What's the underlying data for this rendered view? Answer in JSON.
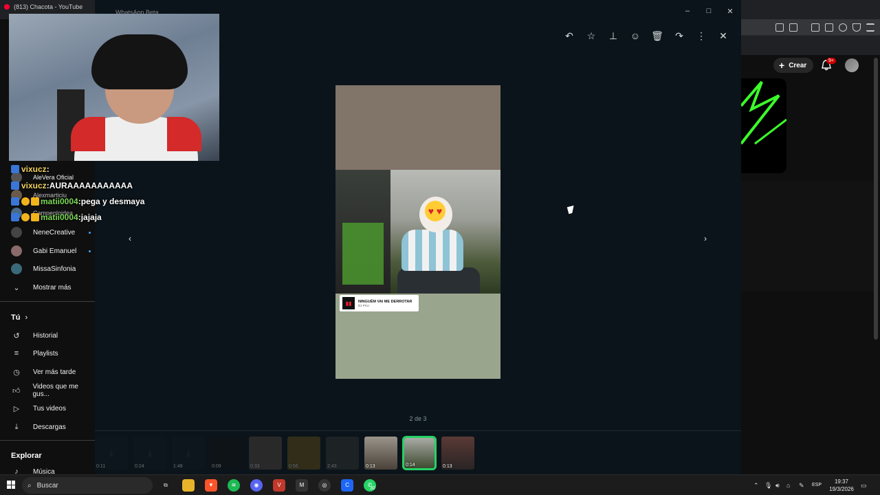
{
  "browser": {
    "tab_title": "(813) Chacota - YouTube",
    "create_label": "Crear",
    "notifications_badge": "9+"
  },
  "sidebar": {
    "subscriptions": [
      {
        "label": "AleVera Oficial"
      },
      {
        "label": "Alexmarticiu"
      },
      {
        "label": "Campeoloidea"
      },
      {
        "label": "NeneCreative"
      },
      {
        "label": "Gabi Emanuel"
      },
      {
        "label": "MissaSinfonia"
      }
    ],
    "show_more": "Mostrar más",
    "you_heading": "Tú",
    "you_items": [
      {
        "label": "Historial",
        "icon": "history-icon"
      },
      {
        "label": "Playlists",
        "icon": "playlists-icon"
      },
      {
        "label": "Ver más tarde",
        "icon": "watch-later-icon"
      },
      {
        "label": "Videos que me gus...",
        "icon": "liked-videos-icon"
      },
      {
        "label": "Tus videos",
        "icon": "your-videos-icon"
      },
      {
        "label": "Descargas",
        "icon": "downloads-icon"
      }
    ],
    "explore_heading": "Explorar",
    "explore_items": [
      {
        "label": "Música",
        "icon": "music-icon"
      }
    ]
  },
  "chat": [
    {
      "user": "vixucz",
      "sep": " :",
      "message": ""
    },
    {
      "user": "vixucz",
      "sep": " :",
      "message": " AURAAAAAAAAAAA"
    },
    {
      "user": "matii0004",
      "sep": " :",
      "message": " pega y desmaya"
    },
    {
      "user": "matii0004",
      "sep": " :",
      "message": " jajaja"
    }
  ],
  "whatsapp": {
    "window_title": "WhatsApp Beta",
    "counter": "2 de 3",
    "music": {
      "title": "NINGUÉM VAI ME DERROTAR",
      "artist": "DJ FKU"
    },
    "thumbnails": [
      {
        "duration": "0:11"
      },
      {
        "duration": "0:24"
      },
      {
        "duration": "1:48"
      },
      {
        "duration": "0:09"
      },
      {
        "duration": "0:33"
      },
      {
        "duration": "0:56"
      },
      {
        "duration": "2:43"
      },
      {
        "duration": "0:13"
      },
      {
        "duration": "0:14"
      },
      {
        "duration": "0:13"
      }
    ]
  },
  "taskbar": {
    "search_placeholder": "Buscar",
    "whatsapp_badge": "30",
    "language": "ESP",
    "time": "19:37",
    "date": "19/3/2026"
  },
  "colors": {
    "whatsapp_bg": "#0b141a",
    "youtube_bg": "#0f0f0f",
    "accent_green": "#25d366"
  }
}
